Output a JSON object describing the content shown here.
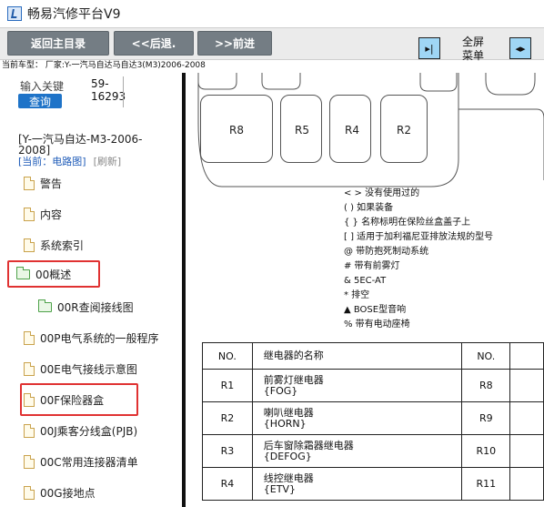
{
  "window": {
    "title": "畅易汽修平台V9",
    "icon": "car-diagnostic-icon"
  },
  "toolbar": {
    "back_main": "返回主目录",
    "back": "<<后退.",
    "forward": ">>前进",
    "fullscreen_line1": "全屏",
    "fullscreen_line2": "菜单",
    "left_toggle_icon": "panel-collapse-icon",
    "right_toggle_icon": "panel-expand-icon"
  },
  "car_type": "当前车型：  厂家:Y-一汽马自达马自达3(M3)2006-2008",
  "search": {
    "label": "输入关键",
    "value": "59-16293",
    "button": "查询"
  },
  "breadcrumb": "[Y-一汽马自达-M3-2006-2008]",
  "current": {
    "label": "[当前：电路图]",
    "refresh": "[刷新]"
  },
  "tree": [
    {
      "label": "警告",
      "type": "file"
    },
    {
      "label": "内容",
      "type": "file"
    },
    {
      "label": "系统索引",
      "type": "file"
    },
    {
      "label": "00概述",
      "type": "folder-open"
    },
    {
      "label": "00R查阅接线图",
      "type": "folder"
    },
    {
      "label": "00P电气系统的一般程序",
      "type": "file"
    },
    {
      "label": "00E电气接线示意图",
      "type": "file"
    },
    {
      "label": "00F保险器盒",
      "type": "file"
    },
    {
      "label": "00J乘客分线盒(PJB)",
      "type": "file"
    },
    {
      "label": "00C常用连接器清单",
      "type": "file"
    },
    {
      "label": "00G接地点",
      "type": "file"
    }
  ],
  "diagram": {
    "relays": [
      "R8",
      "R5",
      "R4",
      "R2"
    ],
    "legend": [
      "< > 没有使用过的",
      "( ) 如果装备",
      "{ } 名称标明在保险丝盒盖子上",
      "[ ] 适用于加利福尼亚排放法规的型号",
      "@  带防抱死制动系统",
      "#  带有前雾灯",
      "&  5EC-AT",
      "*  排空",
      "▲  BOSE型音响",
      "%  带有电动座椅"
    ],
    "table": {
      "headers": [
        "NO.",
        "继电器的名称",
        "NO."
      ],
      "rows": [
        {
          "no": "R1",
          "name": "前雾灯继电器",
          "code": "{FOG}",
          "no2": "R8"
        },
        {
          "no": "R2",
          "name": "喇叭继电器",
          "code": "{HORN}",
          "no2": "R9"
        },
        {
          "no": "R3",
          "name": "后车窗除霜器继电器",
          "code": "{DEFOG}",
          "no2": "R10"
        },
        {
          "no": "R4",
          "name": "线控继电器",
          "code": "{ETV}",
          "no2": "R11"
        }
      ]
    }
  }
}
